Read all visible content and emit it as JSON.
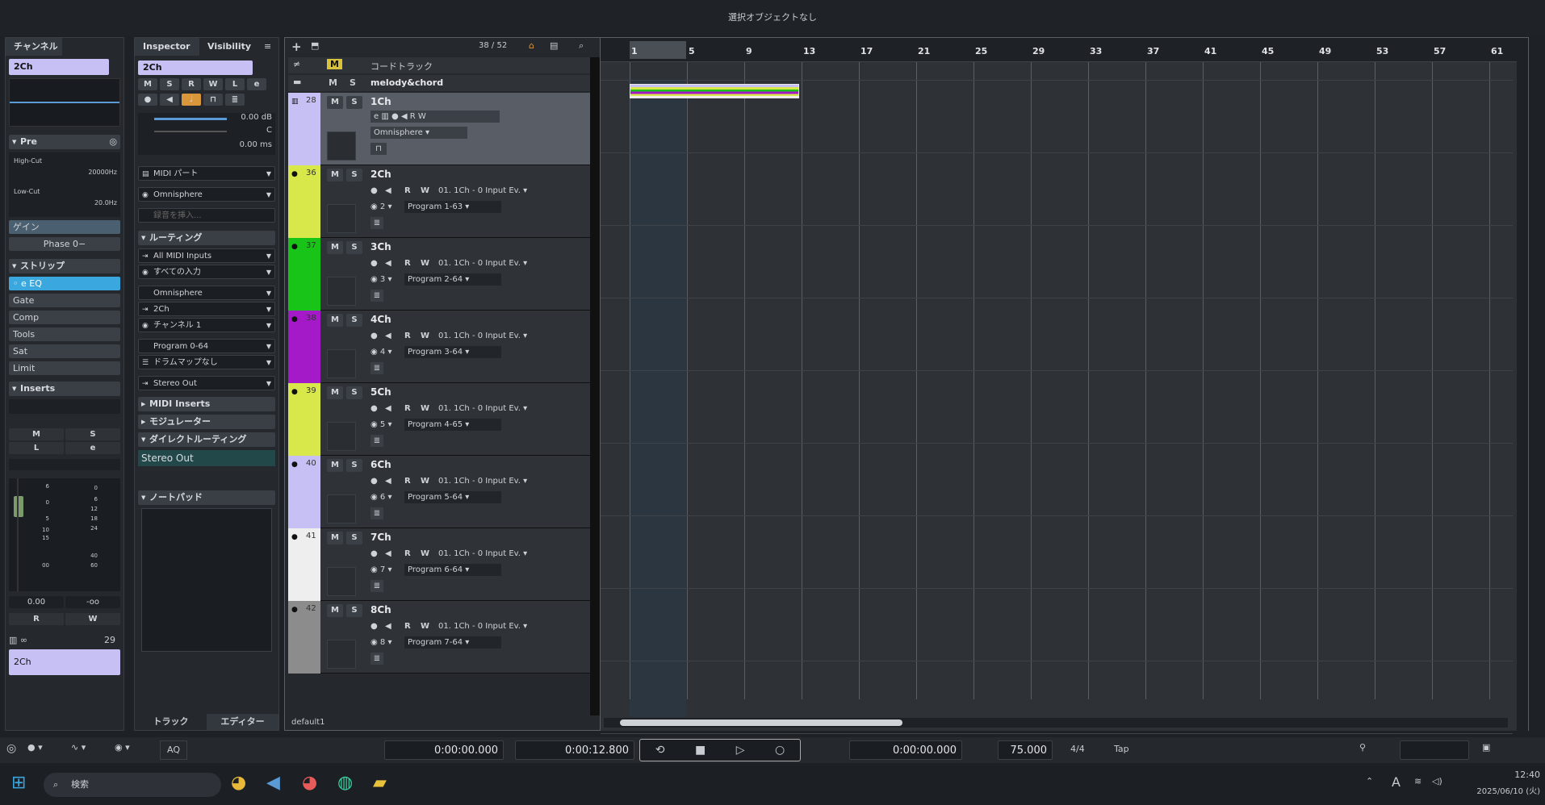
{
  "titlebar": {
    "text": "選択オブジェクトなし"
  },
  "channel": {
    "tab": "チャンネル",
    "name": "2Ch",
    "pre": "Pre",
    "highcut_label": "High-Cut",
    "highcut_value": "20000Hz",
    "lowcut_label": "Low-Cut",
    "lowcut_value": "20.0Hz",
    "gain": "ゲイン",
    "phase": "Phase 0−",
    "strip": "ストリップ",
    "strip_items": [
      "EQ",
      "Gate",
      "Comp",
      "Tools",
      "Sat",
      "Limit"
    ],
    "inserts": "Inserts",
    "m": "M",
    "s": "S",
    "l": "L",
    "e": "e",
    "vol": "0.00",
    "pan": "-oo",
    "r": "R",
    "w": "W",
    "bottom_num": "29",
    "bottom_name": "2Ch",
    "scale_left": [
      "6",
      "0",
      "5",
      "10",
      "15",
      "00"
    ],
    "scale_right": [
      "0",
      "6",
      "12",
      "18",
      "24",
      "40",
      "60"
    ]
  },
  "inspector": {
    "tab_inspector": "Inspector",
    "tab_visibility": "Visibility",
    "track_name": "2Ch",
    "btns": [
      "M",
      "S",
      "R",
      "W",
      "L",
      "e"
    ],
    "vol": "0.00 dB",
    "pan": "C",
    "delay": "0.00 ms",
    "midi_part": "MIDI パート",
    "instrument": "Omnisphere",
    "insert_hint": "録音を挿入...",
    "routing": "ルーティング",
    "input": "All MIDI Inputs",
    "input2": "すべての入力",
    "output": "Omnisphere",
    "out2": "2Ch",
    "channel": "チャンネル 1",
    "program": "Program 0-64",
    "drummap": "ドラムマップなし",
    "stereo_out": "Stereo Out",
    "midi_inserts": "MIDI Inserts",
    "modulator": "モジュレーター",
    "direct_routing": "ダイレクトルーティング",
    "direct_out": "Stereo Out",
    "notepad": "ノートパッド",
    "foot_track": "トラック",
    "foot_editor": "エディター"
  },
  "tracklist": {
    "count": "38 / 52",
    "chord_track": "コードトラック",
    "folder": "melody&chord",
    "footer": "default1",
    "tracks": [
      {
        "num": "28",
        "name": "1Ch",
        "color": "#c7c0f5",
        "plugin": "Omnisphere"
      },
      {
        "num": "36",
        "name": "2Ch",
        "color": "#d8e84a",
        "ch": "2",
        "input": "01. 1Ch - 0 Input Ev.",
        "program": "Program 1-63"
      },
      {
        "num": "37",
        "name": "3Ch",
        "color": "#17c417",
        "ch": "3",
        "input": "01. 1Ch - 0 Input Ev.",
        "program": "Program 2-64"
      },
      {
        "num": "38",
        "name": "4Ch",
        "color": "#a41ac8",
        "ch": "4",
        "input": "01. 1Ch - 0 Input Ev.",
        "program": "Program 3-64"
      },
      {
        "num": "39",
        "name": "5Ch",
        "color": "#d8e84a",
        "ch": "5",
        "input": "01. 1Ch - 0 Input Ev.",
        "program": "Program 4-65"
      },
      {
        "num": "40",
        "name": "6Ch",
        "color": "#c7c0f5",
        "ch": "6",
        "input": "01. 1Ch - 0 Input Ev.",
        "program": "Program 5-64"
      },
      {
        "num": "41",
        "name": "7Ch",
        "color": "#eeeeee",
        "ch": "7",
        "input": "01. 1Ch - 0 Input Ev.",
        "program": "Program 6-64"
      },
      {
        "num": "42",
        "name": "8Ch",
        "color": "#8c8c8c",
        "ch": "8",
        "input": "01. 1Ch - 0 Input Ev.",
        "program": "Program 7-64"
      }
    ]
  },
  "ruler": {
    "bars": [
      "1",
      "5",
      "9",
      "13",
      "17",
      "21",
      "25",
      "29",
      "33",
      "37",
      "41",
      "45",
      "49",
      "53",
      "57",
      "61"
    ]
  },
  "transport": {
    "aq": "AQ",
    "pos_left": "0:00:00.000",
    "pos_right": "0:00:12.800",
    "time": "0:00:00.000",
    "tempo": "75.000",
    "signature": "4/4",
    "tap": "Tap"
  },
  "taskbar": {
    "search": "検索",
    "time": "12:40",
    "date": "2025/06/10 (火)",
    "ime": "A"
  }
}
